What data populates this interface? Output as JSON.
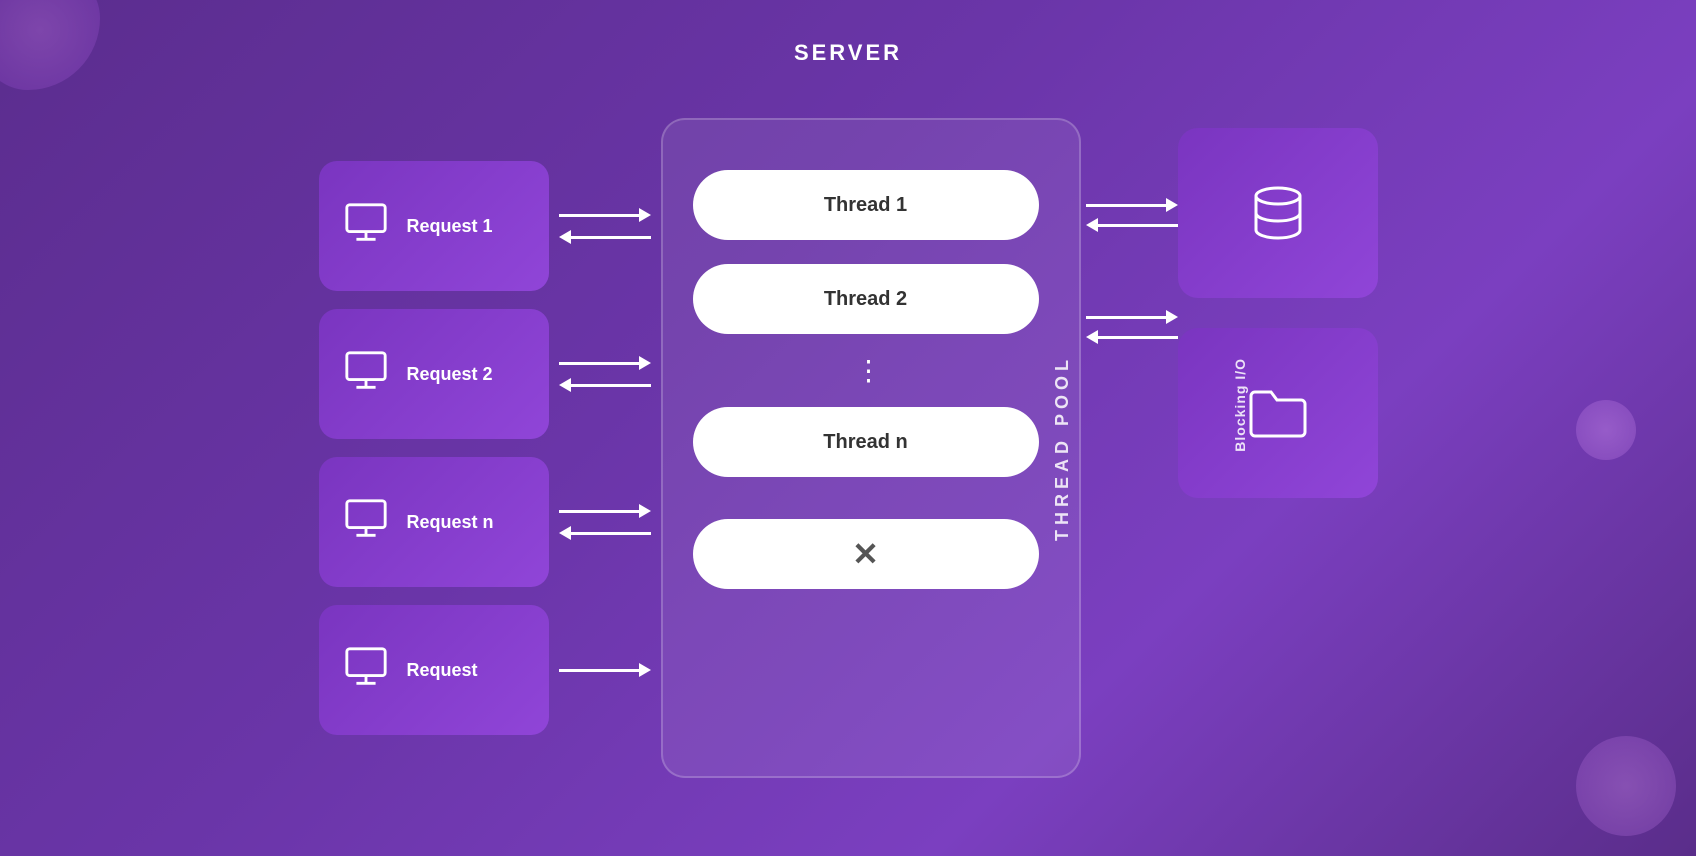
{
  "server": {
    "label": "SERVER",
    "thread_pool_label": "THREAD POOL"
  },
  "requests": [
    {
      "id": 1,
      "label": "Request 1"
    },
    {
      "id": 2,
      "label": "Request 2"
    },
    {
      "id": 3,
      "label": "Request n"
    },
    {
      "id": 4,
      "label": "Request"
    }
  ],
  "threads": [
    {
      "id": 1,
      "label": "Thread 1"
    },
    {
      "id": 2,
      "label": "Thread 2"
    },
    {
      "id": 3,
      "label": "..."
    },
    {
      "id": 4,
      "label": "Thread n"
    },
    {
      "id": 5,
      "label": "×",
      "rejected": true
    }
  ],
  "resources": [
    {
      "id": 1,
      "type": "database"
    },
    {
      "id": 2,
      "type": "folder"
    }
  ],
  "blocking_label": "Blocking I/O",
  "colors": {
    "background_start": "#5b2d8e",
    "background_end": "#6a35a8",
    "box_bg": "#7a35c0",
    "server_border": "rgba(255,255,255,0.2)"
  }
}
